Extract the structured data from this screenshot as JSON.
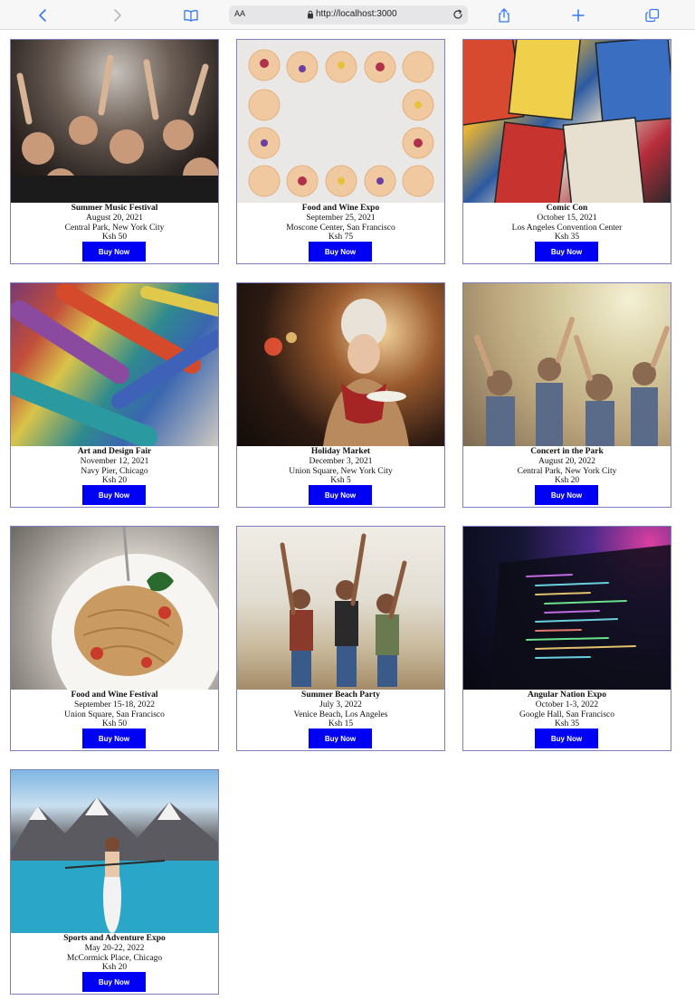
{
  "browser": {
    "text_size_label": "AA",
    "url": "http://localhost:3000"
  },
  "events": [
    {
      "title": "Summer Music Festival",
      "date": "August 20, 2021",
      "location": "Central Park, New York City",
      "price": "Ksh 50",
      "button": "Buy Now"
    },
    {
      "title": "Food and Wine Expo",
      "date": "September 25, 2021",
      "location": "Moscone Center, San Francisco",
      "price": "Ksh 75",
      "button": "Buy Now"
    },
    {
      "title": "Comic Con",
      "date": "October 15, 2021",
      "location": "Los Angeles Convention Center",
      "price": "Ksh 35",
      "button": "Buy Now"
    },
    {
      "title": "Art and Design Fair",
      "date": "November 12, 2021",
      "location": "Navy Pier, Chicago",
      "price": "Ksh 20",
      "button": "Buy Now"
    },
    {
      "title": "Holiday Market",
      "date": "December 3, 2021",
      "location": "Union Square, New York City",
      "price": "Ksh 5",
      "button": "Buy Now"
    },
    {
      "title": "Concert in the Park",
      "date": "August 20, 2022",
      "location": "Central Park, New York City",
      "price": "Ksh 20",
      "button": "Buy Now"
    },
    {
      "title": "Food and Wine Festival",
      "date": "September 15-18, 2022",
      "location": "Union Square, San Francisco",
      "price": "Ksh 50",
      "button": "Buy Now"
    },
    {
      "title": "Summer Beach Party",
      "date": "July 3, 2022",
      "location": "Venice Beach, Los Angeles",
      "price": "Ksh 15",
      "button": "Buy Now"
    },
    {
      "title": "Angular Nation Expo",
      "date": "October 1-3, 2022",
      "location": "Google Hall, San Francisco",
      "price": "Ksh 35",
      "button": "Buy Now"
    },
    {
      "title": "Sports and Adventure Expo",
      "date": "May 20-22, 2022",
      "location": "McCormick Place, Chicago",
      "price": "Ksh 20",
      "button": "Buy Now"
    }
  ],
  "colors": {
    "button_bg": "#0000f5",
    "card_border": "#7f7fbf",
    "toolbar_accent": "#3478f6"
  }
}
